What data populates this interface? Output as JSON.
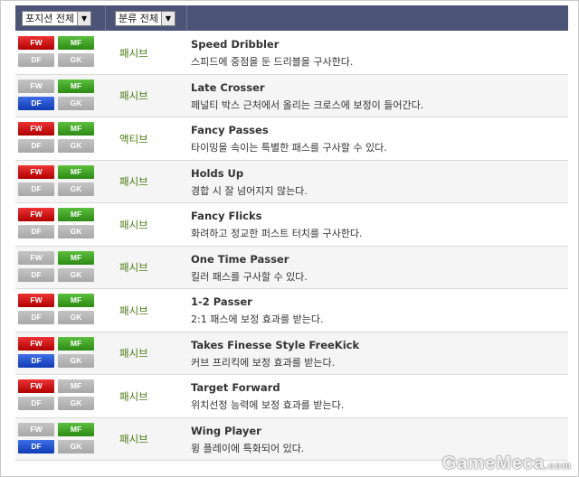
{
  "filters": {
    "position": "포지션 전체",
    "category": "분류 전체"
  },
  "positions": [
    "FW",
    "MF",
    "DF",
    "GK"
  ],
  "traits": [
    {
      "active": [
        "FW",
        "MF"
      ],
      "type": "패시브",
      "name": "Speed Dribbler",
      "desc": "스피드에 중점을 둔 드리블을 구사한다."
    },
    {
      "active": [
        "MF",
        "DF"
      ],
      "type": "패시브",
      "name": "Late Crosser",
      "desc": "페널티 박스 근처에서 올리는 크로스에 보정이 들어간다."
    },
    {
      "active": [
        "FW",
        "MF"
      ],
      "type": "액티브",
      "name": "Fancy Passes",
      "desc": "타이밍을 속이는 특별한 패스를 구사할 수 있다."
    },
    {
      "active": [
        "FW",
        "MF"
      ],
      "type": "패시브",
      "name": "Holds Up",
      "desc": "경합 시 잘 넘어지지 않는다."
    },
    {
      "active": [
        "FW",
        "MF"
      ],
      "type": "패시브",
      "name": "Fancy Flicks",
      "desc": "화려하고 정교한 퍼스트 터치를 구사한다."
    },
    {
      "active": [
        "MF"
      ],
      "type": "패시브",
      "name": "One Time Passer",
      "desc": "킬러 패스를 구사할 수 있다."
    },
    {
      "active": [
        "FW",
        "MF"
      ],
      "type": "패시브",
      "name": "1-2 Passer",
      "desc": "2:1 패스에 보정 효과를 받는다."
    },
    {
      "active": [
        "FW",
        "MF",
        "DF"
      ],
      "type": "패시브",
      "name": "Takes Finesse Style FreeKick",
      "desc": "커브 프리킥에 보정 효과를 받는다."
    },
    {
      "active": [
        "FW"
      ],
      "type": "패시브",
      "name": "Target Forward",
      "desc": "위치선정 능력에 보정 효과를 받는다."
    },
    {
      "active": [
        "MF",
        "DF"
      ],
      "type": "패시브",
      "name": "Wing Player",
      "desc": "윙 플레이에 특화되어 있다."
    }
  ],
  "watermark": {
    "text": "GameMeca",
    "suffix": ".com"
  }
}
